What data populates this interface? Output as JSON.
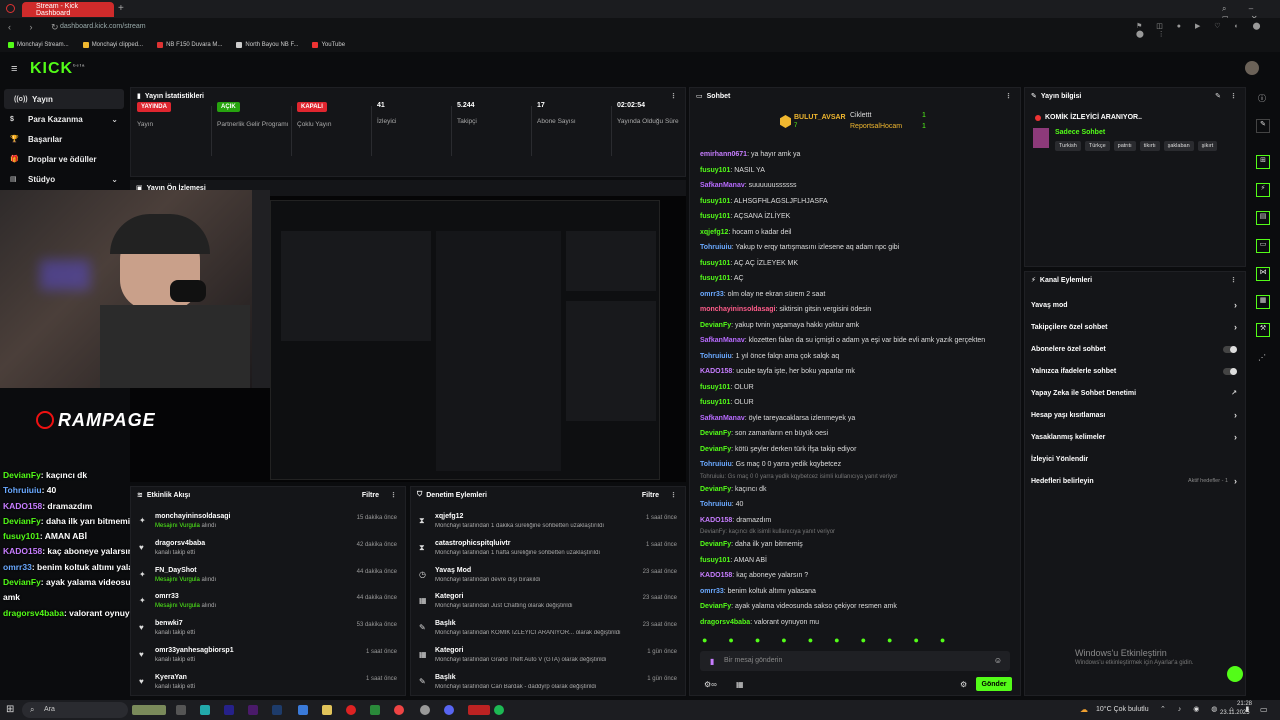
{
  "browser": {
    "tab_title": "Stream - Kick Dashboard",
    "new_tab": "+",
    "url": "dashboard.kick.com/stream",
    "bookmarks": [
      "Monchayi Stream...",
      "Monchayi clipped...",
      "NB F150 Duvara M...",
      "North Bayou NB F...",
      "YouTube"
    ]
  },
  "app": {
    "logo": "KICK",
    "logo_sup": "beta",
    "menu_icon": "≡"
  },
  "sidebar": {
    "items": [
      {
        "label": "Yayın",
        "icon": "((o))",
        "active": true
      },
      {
        "label": "Para Kazanma",
        "icon": "$",
        "chev": "⌄"
      },
      {
        "label": "Başarılar",
        "icon": "🏆"
      },
      {
        "label": "Droplar ve ödüller",
        "icon": "🎁"
      },
      {
        "label": "Stüdyo",
        "icon": "▤",
        "chev": "⌄"
      }
    ]
  },
  "stats": {
    "title": "Yayın İstatistikleri",
    "items": [
      {
        "badge": "YAYINDA",
        "label": "Yayın"
      },
      {
        "badge": "AÇIK",
        "label": "Partnerlik Gelir Programı"
      },
      {
        "badge": "KAPALI",
        "label": "Çoklu Yayın"
      },
      {
        "value": "41",
        "label": "İzleyici"
      },
      {
        "value": "5.244",
        "label": "Takipçi"
      },
      {
        "value": "17",
        "label": "Abone Sayısı"
      },
      {
        "value": "02:02:54",
        "label": "Yayında Olduğu Süre"
      }
    ]
  },
  "preview": {
    "title": "Yayın Ön İzlemesi"
  },
  "overlay": {
    "brand": "RAMPAGE",
    "chat": [
      {
        "user": "DevianFy",
        "msg": "kaçıncı dk",
        "color": "#53fc18"
      },
      {
        "user": "Tohruiuiu",
        "msg": "40",
        "color": "#6aa9ff"
      },
      {
        "user": "KADO158",
        "msg": "dramazdım",
        "color": "#c77dff"
      },
      {
        "user": "DevianFy",
        "msg": "daha ilk yarı bitmemiş",
        "color": "#53fc18"
      },
      {
        "user": "fusuy101",
        "msg": "AMAN ABİ",
        "color": "#53fc18"
      },
      {
        "user": "KADO158",
        "msg": "kaç aboneye yalarsın ?",
        "color": "#c77dff"
      },
      {
        "user": "omrr33",
        "msg": "benim koltuk altımı yalasana",
        "color": "#6aa9ff"
      },
      {
        "user": "DevianFy",
        "msg": "ayak yalama videosunda sakso çekiyor resmen amk",
        "color": "#53fc18"
      },
      {
        "user": "dragorsv4baba",
        "msg": "valorant oynuyon mu",
        "color": "#53fc18"
      }
    ]
  },
  "activity": {
    "title": "Etkinlik Akışı",
    "filter": "Filtre",
    "rows": [
      {
        "name": "monchayininsoldasagi",
        "sub": "Mesajını Vurgula",
        "sub2": "alındı",
        "time": "15 dakika önce",
        "icon": "✦"
      },
      {
        "name": "dragorsv4baba",
        "sub": "kanalı takip etti",
        "sub2": "",
        "time": "42 dakika önce",
        "icon": "♥"
      },
      {
        "name": "FN_DayShot",
        "sub": "Mesajını Vurgula",
        "sub2": "alındı",
        "time": "44 dakika önce",
        "icon": "✦"
      },
      {
        "name": "omrr33",
        "sub": "Mesajını Vurgula",
        "sub2": "alındı",
        "time": "44 dakika önce",
        "icon": "✦"
      },
      {
        "name": "benwki7",
        "sub": "kanalı takip etti",
        "sub2": "",
        "time": "53 dakika önce",
        "icon": "♥"
      },
      {
        "name": "omr33yanhesagbiorsp1",
        "sub": "kanalı takip etti",
        "sub2": "",
        "time": "1 saat önce",
        "icon": "♥"
      },
      {
        "name": "KyeraYan",
        "sub": "kanalı takip etti",
        "sub2": "",
        "time": "1 saat önce",
        "icon": "♥"
      }
    ]
  },
  "moderation": {
    "title": "Denetim Eylemleri",
    "filter": "Filtre",
    "rows": [
      {
        "name": "xqjefg12",
        "sub": "Monchayi tarafından 1 dakika süreliğine sohbetten uzaklaştırıldı",
        "time": "1 saat önce",
        "icon": "⧗"
      },
      {
        "name": "catastrophicspitqluivtr",
        "sub": "Monchayi tarafından 1 hafta süreliğine sohbetten uzaklaştırıldı",
        "time": "1 saat önce",
        "icon": "⧗"
      },
      {
        "name": "Yavaş Mod",
        "sub": "Monchayi tarafından devre dışı bırakıldı",
        "time": "23 saat önce",
        "icon": "◷"
      },
      {
        "name": "Kategori",
        "sub": "Monchayi tarafından Just Chatting olarak değiştirildi",
        "time": "23 saat önce",
        "icon": "▦"
      },
      {
        "name": "Başlık",
        "sub": "Monchayi tarafından KOMİK İZLEYİCİ ARANIYOR... olarak değiştirildi",
        "time": "23 saat önce",
        "icon": "✎"
      },
      {
        "name": "Kategori",
        "sub": "Monchayi tarafından Grand Theft Auto V (GTA) olarak değiştirildi",
        "time": "1 gün önce",
        "icon": "▦"
      },
      {
        "name": "Başlık",
        "sub": "Monchayi tarafından Can Bardak - daddyrp olarak değiştirildi",
        "time": "1 gün önce",
        "icon": "✎"
      }
    ]
  },
  "chat": {
    "title": "Sohbet",
    "leaderboard": [
      {
        "name": "BULUT_AVSAR",
        "count": "7"
      },
      {
        "name": "Ciklettt",
        "count": "1"
      },
      {
        "name": "ReportsalHocam",
        "count": "1"
      }
    ],
    "messages": [
      {
        "user": "emirhann0671",
        "msg": "ya hayır amk ya",
        "color": "#c77dff"
      },
      {
        "user": "fusuy101",
        "msg": "NASIL YA",
        "color": "#53fc18"
      },
      {
        "user": "SafkanManav",
        "msg": "suuuuuussssss",
        "color": "#b86bff"
      },
      {
        "user": "fusuy101",
        "msg": "ALHSGFHLAGSLJFLHJASFA",
        "color": "#53fc18"
      },
      {
        "user": "fusuy101",
        "msg": "AÇSANA İZLİYEK",
        "color": "#53fc18"
      },
      {
        "user": "xqjefg12",
        "msg": "hocam o kadar deil",
        "color": "#53fc18"
      },
      {
        "user": "Tohruiuiu",
        "msg": "Yakup tv erqy tartışmasını izlesene aq adam npc gibi",
        "color": "#6aa9ff"
      },
      {
        "user": "fusuy101",
        "msg": "AÇ AÇ İZLEYEK MK",
        "color": "#53fc18"
      },
      {
        "user": "fusuy101",
        "msg": "AÇ",
        "color": "#53fc18"
      },
      {
        "user": "omrr33",
        "msg": "olm olay ne ekran sürem 2 saat",
        "color": "#6aa9ff"
      },
      {
        "user": "monchayininsoldasagi",
        "msg": "siktirsin gitsin vergisini ödesin",
        "color": "#ff5c8a"
      },
      {
        "user": "DevianFy",
        "msg": "yakup tvnin yaşamaya hakkı yoktur amk",
        "color": "#53fc18"
      },
      {
        "user": "SafkanManav",
        "msg": "klozetten falan da su içmişti o adam ya eşi var bide evli amk yazık gerçekten",
        "color": "#b86bff"
      },
      {
        "user": "Tohruiuiu",
        "msg": "1 yıl önce falqn ama çok salqk aq",
        "color": "#6aa9ff"
      },
      {
        "user": "KADO158",
        "msg": "ucube tayfa işte, her boku yaparlar mk",
        "color": "#c77dff"
      },
      {
        "user": "fusuy101",
        "msg": "OLUR",
        "color": "#53fc18"
      },
      {
        "user": "fusuy101",
        "msg": "OLUR",
        "color": "#53fc18"
      },
      {
        "user": "SafkanManav",
        "msg": "öyle tareyacaklarsa izlenmeyek ya",
        "color": "#b86bff"
      },
      {
        "user": "DevianFy",
        "msg": "son zamanların en büyük oesi",
        "color": "#53fc18"
      },
      {
        "user": "DevianFy",
        "msg": "kötü şeyler derken türk ifşa takip ediyor",
        "color": "#53fc18"
      },
      {
        "user": "Tohruiuiu",
        "msg": "Gs maç 0 0 yarra yedik kqybetcez",
        "color": "#6aa9ff"
      }
    ],
    "reply_line1": "Tohruiuiu: Gs maç 0 0 yarra yedik kqybetcez isimli kullanıcıya yanıt veriyor",
    "messages2": [
      {
        "user": "DevianFy",
        "msg": "kaçıncı dk",
        "color": "#53fc18"
      },
      {
        "user": "Tohruiuiu",
        "msg": "40",
        "color": "#6aa9ff"
      },
      {
        "user": "KADO158",
        "msg": "dramazdım",
        "color": "#c77dff"
      }
    ],
    "reply_line2": "DevianFy: kaçıncı dk isimli kullanıcıya yanıt veriyor",
    "messages3": [
      {
        "user": "DevianFy",
        "msg": "daha ilk yarı bitmemiş",
        "color": "#53fc18"
      },
      {
        "user": "fusuy101",
        "msg": "AMAN ABİ",
        "color": "#53fc18"
      },
      {
        "user": "KADO158",
        "msg": "kaç aboneye yalarsın ?",
        "color": "#c77dff"
      },
      {
        "user": "omrr33",
        "msg": "benim koltuk altımı yalasana",
        "color": "#6aa9ff"
      },
      {
        "user": "DevianFy",
        "msg": "ayak yalama videosunda sakso çekiyor resmen amk",
        "color": "#53fc18"
      },
      {
        "user": "dragorsv4baba",
        "msg": "valorant oynuyon mu",
        "color": "#53fc18"
      }
    ],
    "input_placeholder": "Bir mesaj gönderin",
    "send_label": "Gönder"
  },
  "stream_info": {
    "title": "Yayın bilgisi",
    "stream_title": "KOMİK İZLEYİCİ ARANIYOR..",
    "category": "Sadece Sohbet",
    "tags": [
      "Turkish",
      "Türkçe",
      "patrıtı",
      "tikırtı",
      "şaklaban",
      "şikırt"
    ]
  },
  "channel_actions": {
    "title": "Kanal Eylemleri",
    "items": [
      {
        "label": "Yavaş mod",
        "control": "chevron"
      },
      {
        "label": "Takipçilere özel sohbet",
        "control": "chevron"
      },
      {
        "label": "Abonelere özel sohbet",
        "control": "toggle"
      },
      {
        "label": "Yalnızca ifadelerle sohbet",
        "control": "toggle"
      },
      {
        "label": "Yapay Zeka ile Sohbet Denetimi",
        "control": "external"
      },
      {
        "label": "Hesap yaşı kısıtlaması",
        "control": "chevron"
      },
      {
        "label": "Yasaklanmış kelimeler",
        "control": "chevron"
      },
      {
        "label": "İzleyici Yönlendir",
        "control": "none"
      },
      {
        "label": "Hedefleri belirleyin",
        "control": "chevron",
        "extra": "Aktif hedefler - 1"
      }
    ]
  },
  "watermark": {
    "line1": "Windows'u Etkinleştirin",
    "line2": "Windows'u etkinleştirmek için Ayarlar'a gidin."
  },
  "taskbar": {
    "search_label": "Ara",
    "weather": "10°C  Çok bulutlu",
    "time": "21:28",
    "date": "23.11.2025"
  }
}
